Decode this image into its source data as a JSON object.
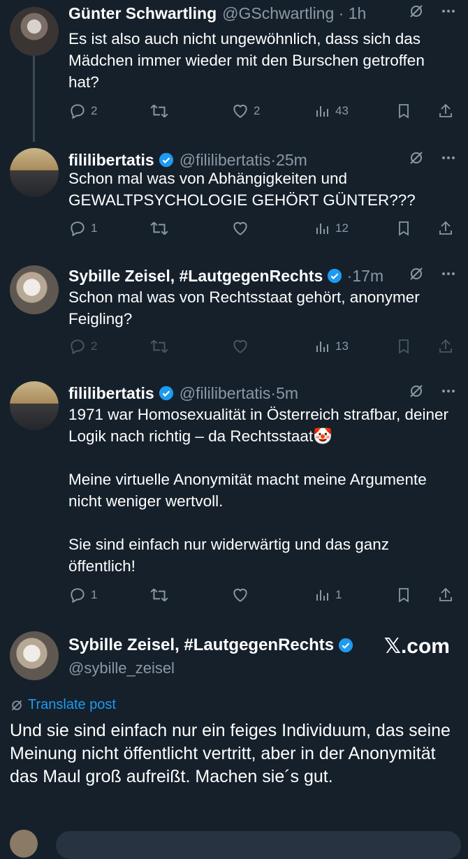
{
  "tweets": [
    {
      "name": "Günter Schwartling",
      "handle": "@GSchwartling",
      "time": "1h",
      "verified": false,
      "body": "Es ist also auch nicht ungewöhnlich, dass sich das Mädchen immer wieder mit den Burschen getroffen hat?",
      "replies": "2",
      "reposts": "",
      "likes": "2",
      "views": "43"
    },
    {
      "name": "fililibertatis",
      "handle": "@fililibertatis",
      "time": "25m",
      "verified": true,
      "body": "Schon mal was von Abhängigkeiten und GEWALTPSYCHOLOGIE GEHÖRT GÜNTER???",
      "replies": "1",
      "reposts": "",
      "likes": "",
      "views": "12"
    },
    {
      "name": "Sybille Zeisel, #LautgegenRechts",
      "handle": "",
      "time": "17m",
      "verified": true,
      "body": "Schon mal was von Rechtsstaat gehört, anonymer Feigling?",
      "replies": "2",
      "reposts": "",
      "likes": "",
      "views": "13"
    },
    {
      "name": "fililibertatis",
      "handle": "@fililibertatis",
      "time": "5m",
      "verified": true,
      "body_lines": [
        "1971 war Homosexualität in Österreich strafbar, deiner Logik nach richtig – da Rechtsstaat🤡",
        "Meine virtuelle Anonymität macht meine Argumente nicht weniger wertvoll.",
        "Sie sind einfach nur widerwärtig und das ganz öffentlich!"
      ],
      "replies": "1",
      "reposts": "",
      "likes": "",
      "views": "1"
    }
  ],
  "main_post": {
    "name": "Sybille Zeisel, #LautgegenRechts",
    "handle": "@sybille_zeisel",
    "verified": true,
    "translate_label": "Translate post",
    "body": "Und sie sind einfach nur ein feiges Individuum, das seine Meinung nicht öffentlicht vertritt, aber in der Anonymität das Maul groß aufreißt. Machen sie´s gut."
  },
  "watermark": "𝕏.com",
  "colors": {
    "background": "#15202b",
    "accent": "#1d9bf0",
    "muted": "#8b98a5"
  },
  "icons": [
    "reply-icon",
    "repost-icon",
    "like-icon",
    "views-icon",
    "bookmark-icon",
    "share-icon",
    "grok-icon",
    "more-icon",
    "verified-badge-icon"
  ]
}
